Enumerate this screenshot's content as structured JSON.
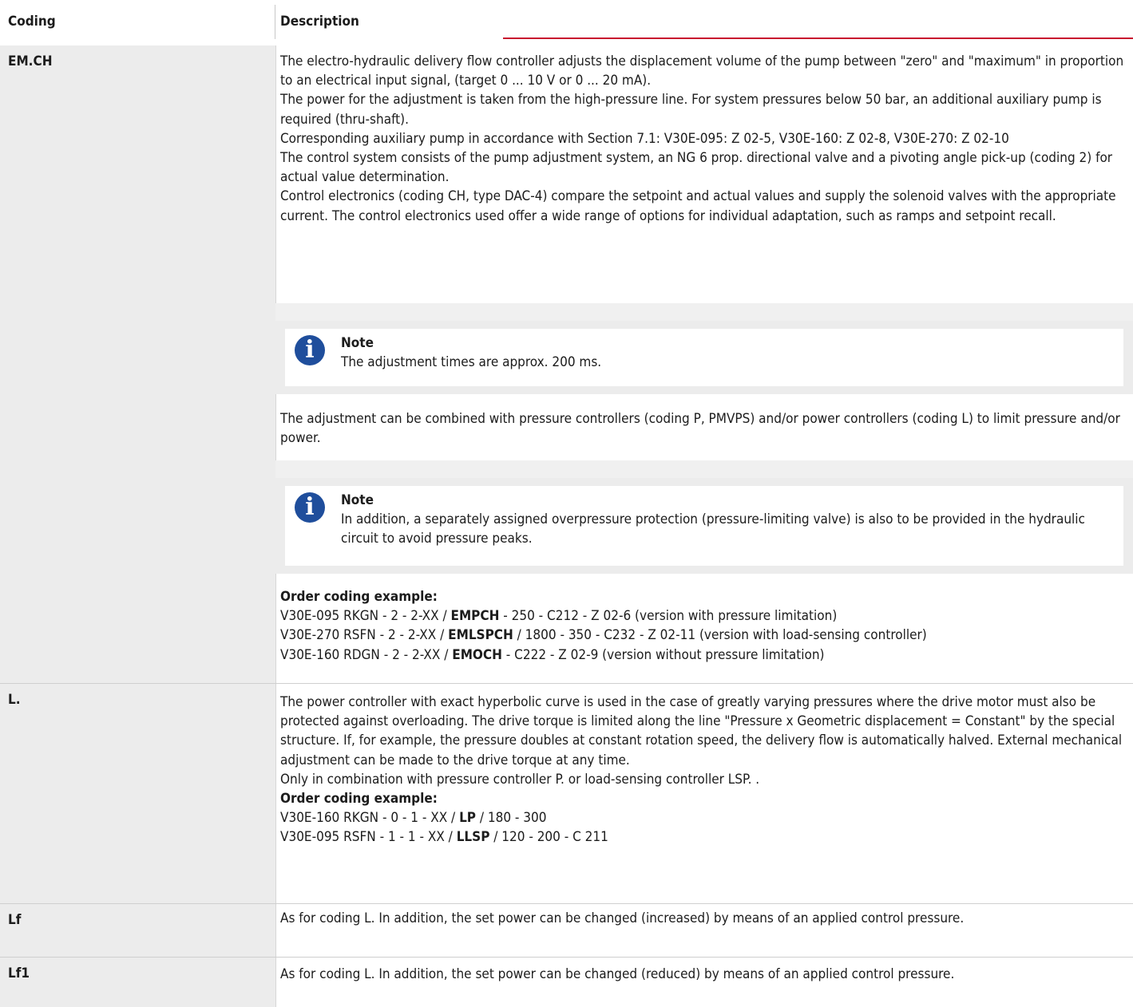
{
  "header": {
    "coding": "Coding",
    "description": "Description"
  },
  "rows": [
    {
      "code": "EM.CH",
      "paragraphs": [
        "The electro-hydraulic delivery flow controller adjusts the displacement volume of the pump between \"zero\" and \"maximum\" in proportion to an electrical input signal, (target 0 ... 10 V or 0 ... 20 mA).",
        "The power for the adjustment is taken from the high-pressure line. For system pressures below 50 bar, an additional auxiliary pump is required (thru-shaft).",
        "Corresponding auxiliary pump in accordance with Section 7.1: V30E-095: Z 02-5, V30E-160: Z 02-8, V30E-270: Z 02-10",
        "The control system consists of the pump adjustment system, an NG 6 prop. directional valve and a pivoting angle pick-up (coding 2) for actual value determination.",
        "Control electronics (coding CH, type DAC-4) compare the setpoint and actual values and supply the solenoid valves with the appropriate current. The control electronics used offer a wide range of options for individual adaptation, such as ramps and setpoint recall."
      ],
      "note1": {
        "title": "Note",
        "text": "The adjustment times are approx. 200 ms."
      },
      "middle": "The adjustment can be combined with pressure controllers (coding P, PMVPS) and/or power controllers (coding L) to limit pressure and/or power.",
      "note2": {
        "title": "Note",
        "text": "In addition, a separately assigned overpressure protection (pressure-limiting valve) is also to be provided in the hydraulic circuit to avoid pressure peaks."
      },
      "order_title": "Order coding example:",
      "examples": [
        {
          "pre": "V30E-095 RKGN - 2 - 2-XX / ",
          "bold": "EMPCH",
          "post": " - 250 - C212 - Z 02-6 (version with pressure limitation)"
        },
        {
          "pre": "V30E-270 RSFN - 2 - 2-XX / ",
          "bold": "EMLSPCH",
          "post": " / 1800 - 350 - C232 - Z 02-11 (version with load-sensing controller)"
        },
        {
          "pre": "V30E-160 RDGN - 2 - 2-XX / ",
          "bold": "EMOCH",
          "post": " - C222 - Z 02-9 (version without pressure limitation)"
        }
      ]
    },
    {
      "code": "L.",
      "text": "The power controller with exact hyperbolic curve is used in the case of greatly varying pressures where the drive motor must also be protected against overloading. The drive torque is limited along the line \"Pressure x Geometric displacement = Constant\" by the special structure. If, for example, the pressure doubles at constant rotation speed, the delivery flow is automatically halved. External mechanical adjustment can be made to the drive torque at any time.",
      "text2": "Only in combination with pressure controller P. or load-sensing controller LSP. .",
      "order_title": "Order coding example:",
      "examples": [
        {
          "pre": "V30E-160 RKGN - 0 - 1 - XX / ",
          "bold": "LP",
          "post": " / 180 - 300"
        },
        {
          "pre": "V30E-095 RSFN - 1 - 1 - XX / ",
          "bold": "LLSP",
          "post": " / 120 - 200 - C 211"
        }
      ]
    },
    {
      "code": "Lf",
      "text": "As for coding L. In addition, the set power can be changed (increased) by means of an applied control pressure."
    },
    {
      "code": "Lf1",
      "text": "As for coding L. In addition, the set power can be changed (reduced) by means of an applied control pressure."
    }
  ]
}
